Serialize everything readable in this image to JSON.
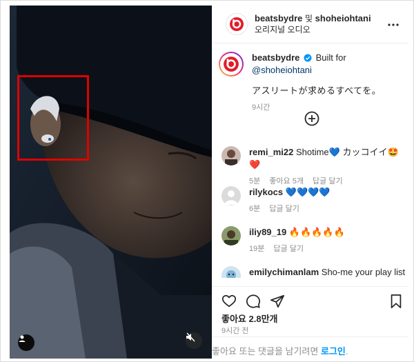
{
  "post": {
    "header": {
      "author": "beatsbydre",
      "conjunction": "및",
      "collaborator": "shoheiohtani",
      "audio": "오리지널 오디오",
      "more_icon": "more-horizontal-icon"
    },
    "caption": {
      "author": "beatsbydre",
      "built_for": "Built for",
      "mention": "@shoheiohtani",
      "text": "アスリートが求めるすべてを。",
      "time": "9시간"
    },
    "comments": [
      {
        "user": "remi_mi22",
        "text": "Shotime💙 カッコイイ🤩❤️",
        "time": "5분",
        "likes": "좋아요 5개",
        "reply": "답글 달기"
      },
      {
        "user": "rilykocs",
        "text": "💙💙💙💙",
        "time": "6분",
        "likes": "",
        "reply": "답글 달기"
      },
      {
        "user": "iliy89_19",
        "text": "🔥🔥🔥🔥🔥",
        "time": "19분",
        "likes": "",
        "reply": "답글 달기"
      },
      {
        "user": "emilychimanlam",
        "text": "Sho-me your play list",
        "time": "",
        "likes": "",
        "reply": ""
      }
    ],
    "likes_text": "좋아요 2.8만개",
    "post_time": "9시간 전",
    "login_prompt": "좋아요 또는 댓글을 남기려면",
    "login_link": "로그인",
    "login_suffix": ".",
    "colors": {
      "link": "#00376b",
      "login": "#0095f6",
      "muted": "#8e8e8e",
      "highlight": "#e00000"
    }
  }
}
